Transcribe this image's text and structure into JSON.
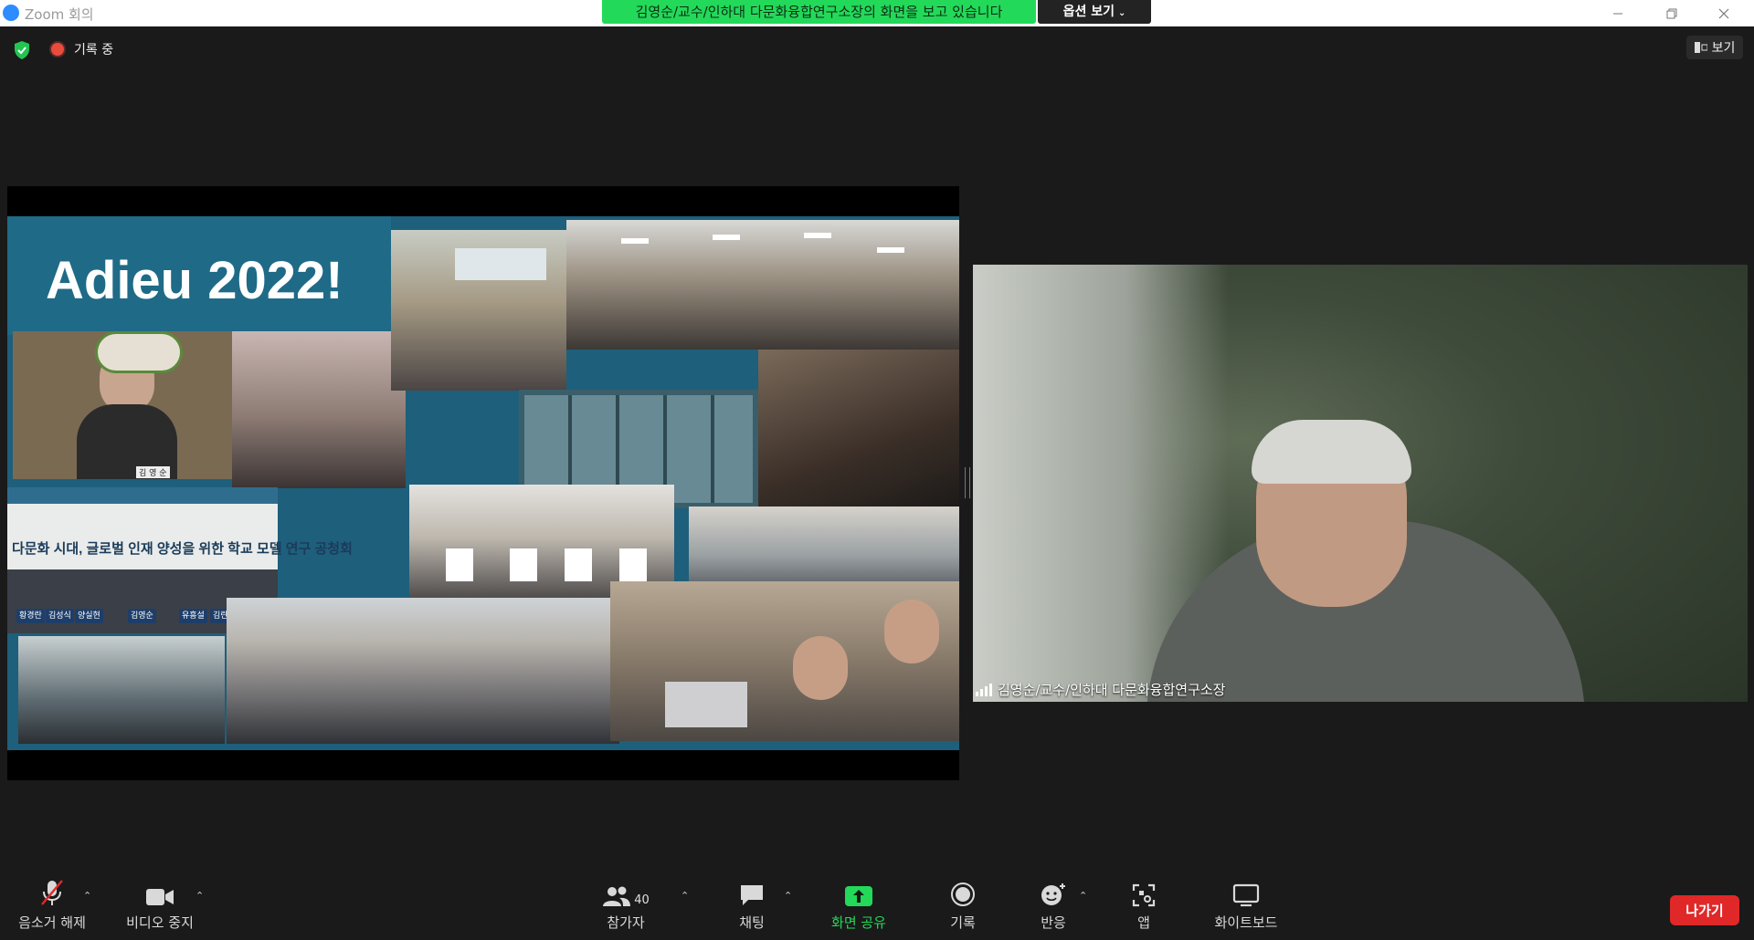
{
  "window": {
    "title": "Zoom 회의",
    "share_banner": "김영순/교수/인하대 다문화융합연구소장의 화면을 보고 있습니다",
    "view_options": "옵션 보기"
  },
  "top_bar": {
    "recording_label": "기록 중",
    "view_label": "보기"
  },
  "shared_screen": {
    "slide_title": "Adieu 2022!",
    "banner_text": "다문화 시대, 글로벌 인재 양성을 위한 학교 모델 연구 공청회",
    "nameplates": [
      "황경란",
      "김성식",
      "양실현",
      "김영순",
      "유흥설",
      "김란미"
    ],
    "name_tag": "김 영 순"
  },
  "speaker": {
    "name": "김영순/교수/인하대 다문화융합연구소장"
  },
  "toolbar": {
    "mute_label": "음소거 해제",
    "video_label": "비디오 중지",
    "participants_label": "참가자",
    "participants_count": "40",
    "chat_label": "채팅",
    "share_label": "화면 공유",
    "record_label": "기록",
    "reactions_label": "반응",
    "apps_label": "앱",
    "whiteboard_label": "화이트보드",
    "leave_label": "나가기"
  },
  "colors": {
    "share_green": "#23d959",
    "leave_red": "#e02828",
    "zoom_blue": "#2d8cff",
    "slide_teal": "#1e5f7b"
  }
}
